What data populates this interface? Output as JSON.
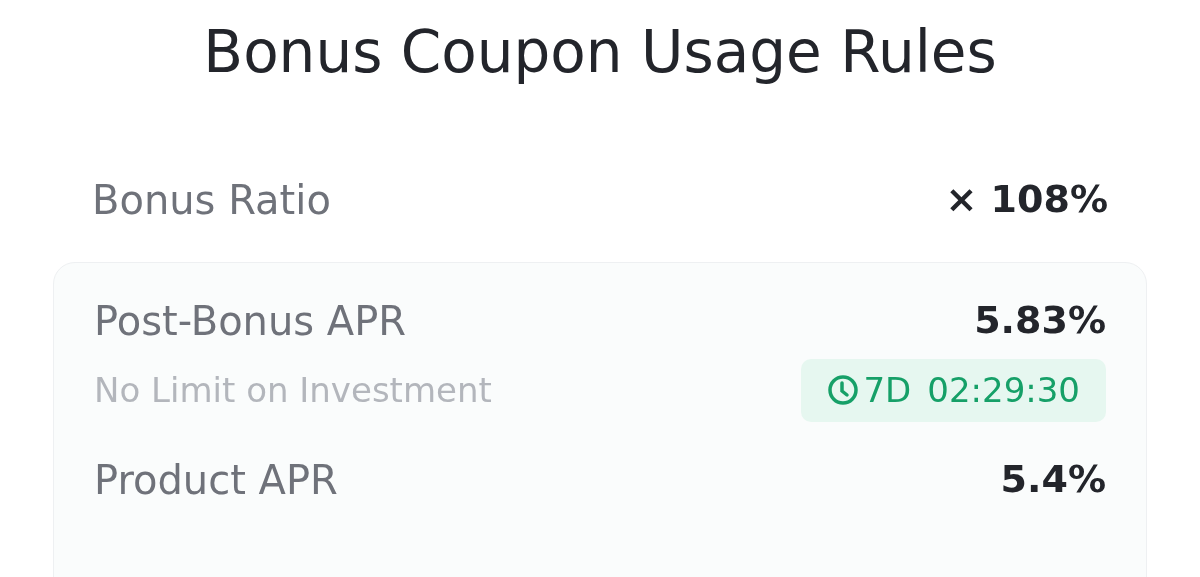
{
  "title": "Bonus Coupon Usage Rules",
  "bonus_ratio": {
    "label": "Bonus Ratio",
    "value": "× 108%"
  },
  "card": {
    "rows": [
      {
        "label": "Post-Bonus APR",
        "value": "5.83%",
        "note": "No Limit on Investment",
        "timer": {
          "days": "7D",
          "time": "02:29:30"
        }
      },
      {
        "label": "Product APR",
        "value": "5.4%"
      }
    ]
  }
}
